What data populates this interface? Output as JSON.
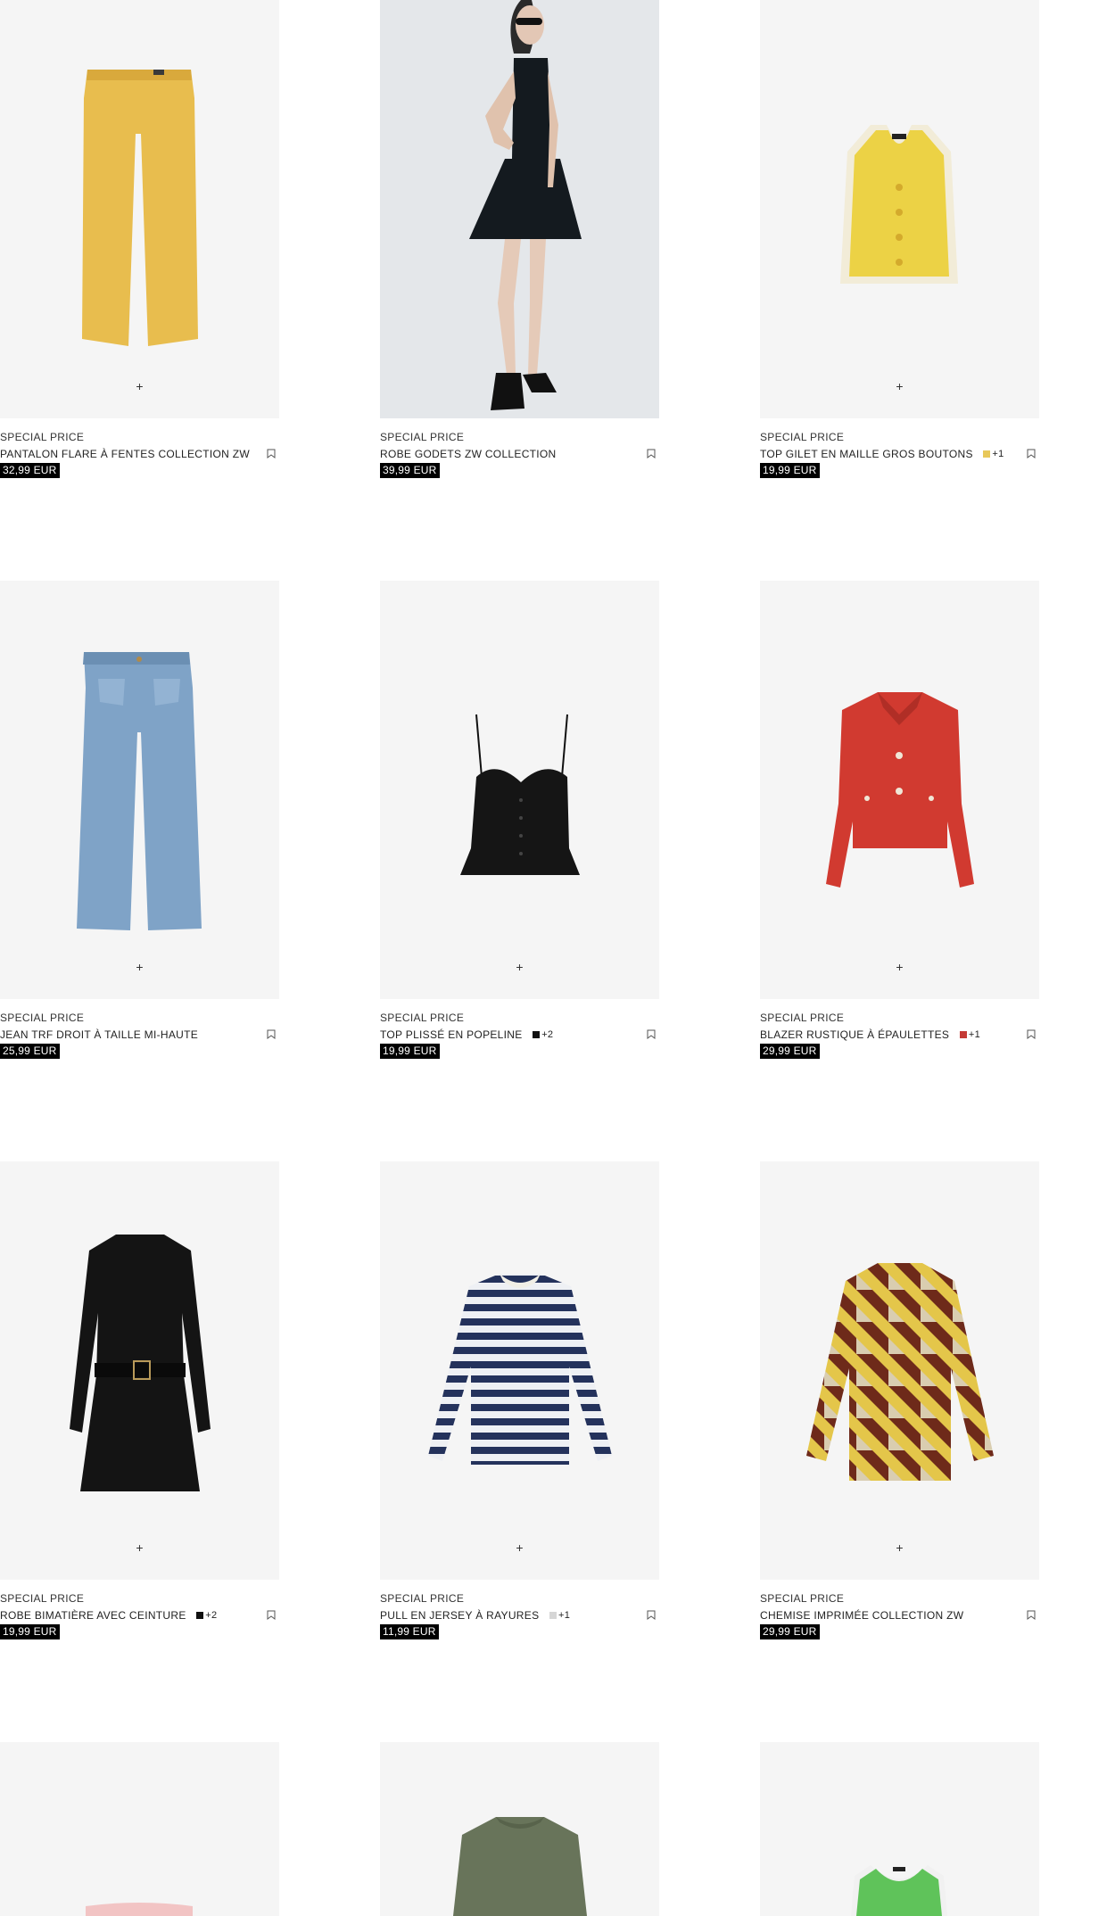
{
  "products": [
    {
      "badge": "SPECIAL PRICE",
      "name": "PANTALON FLARE À FENTES COLLECTION ZW",
      "price": "32,99 EUR",
      "quick_add": "+",
      "swatches": [],
      "more_colors": "",
      "image": "yellow-flare-trousers"
    },
    {
      "badge": "SPECIAL PRICE",
      "name": "ROBE GODETS ZW COLLECTION",
      "price": "39,99 EUR",
      "quick_add": "",
      "swatches": [],
      "more_colors": "",
      "image": "model-black-dress"
    },
    {
      "badge": "SPECIAL PRICE",
      "name": "TOP GILET EN MAILLE GROS BOUTONS",
      "price": "19,99 EUR",
      "quick_add": "+",
      "swatches": [
        "#e8c85a"
      ],
      "more_colors": "+1",
      "image": "yellow-knit-vest"
    },
    {
      "badge": "SPECIAL PRICE",
      "name": "JEAN TRF DROIT À TAILLE MI-HAUTE",
      "price": "25,99 EUR",
      "quick_add": "+",
      "swatches": [],
      "more_colors": "",
      "image": "blue-straight-jeans"
    },
    {
      "badge": "SPECIAL PRICE",
      "name": "TOP PLISSÉ EN POPELINE",
      "price": "19,99 EUR",
      "quick_add": "+",
      "swatches": [
        "#111111"
      ],
      "more_colors": "+2",
      "image": "black-poplin-top"
    },
    {
      "badge": "SPECIAL PRICE",
      "name": "BLAZER RUSTIQUE À ÉPAULETTES",
      "price": "29,99 EUR",
      "quick_add": "+",
      "swatches": [
        "#c43a35"
      ],
      "more_colors": "+1",
      "image": "red-blazer"
    },
    {
      "badge": "SPECIAL PRICE",
      "name": "ROBE BIMATIÈRE AVEC CEINTURE",
      "price": "19,99 EUR",
      "quick_add": "+",
      "swatches": [
        "#111111"
      ],
      "more_colors": "+2",
      "image": "black-belted-dress"
    },
    {
      "badge": "SPECIAL PRICE",
      "name": "PULL EN JERSEY À RAYURES",
      "price": "11,99 EUR",
      "quick_add": "+",
      "swatches": [
        "#d6d6d6"
      ],
      "more_colors": "+1",
      "image": "striped-jersey-sweater"
    },
    {
      "badge": "SPECIAL PRICE",
      "name": "CHEMISE IMPRIMÉE COLLECTION ZW",
      "price": "29,99 EUR",
      "quick_add": "+",
      "swatches": [],
      "more_colors": "",
      "image": "printed-shirt"
    },
    {
      "image": "pink-knit-top"
    },
    {
      "image": "khaki-tshirt"
    },
    {
      "image": "green-tank-top"
    }
  ],
  "icons": {
    "bookmark": "bookmark-icon",
    "quick_add": "plus-icon"
  },
  "colors": {
    "image_background": "#f5f5f5",
    "price_background": "#000000",
    "price_text": "#ffffff"
  }
}
